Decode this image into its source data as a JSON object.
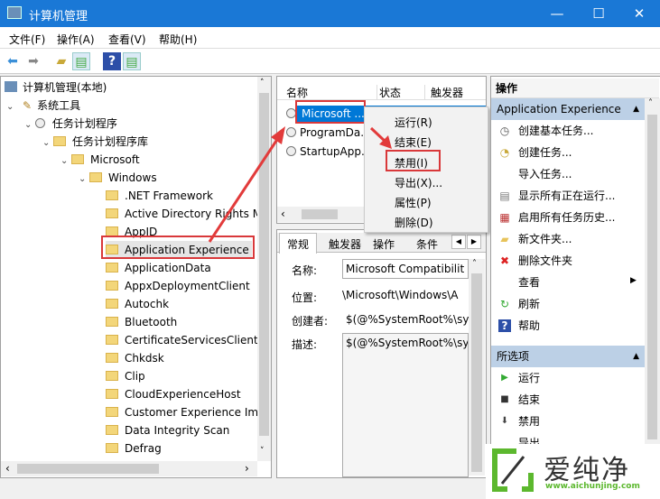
{
  "window": {
    "title": "计算机管理",
    "minimize": "—",
    "maximize": "☐",
    "close": "✕"
  },
  "menu": [
    "文件(F)",
    "操作(A)",
    "查看(V)",
    "帮助(H)"
  ],
  "toolbar": [
    "back-icon",
    "forward-icon",
    "up-folder-icon",
    "show-hide-tree-icon",
    "help-icon",
    "show-hide-action-pane-icon"
  ],
  "tree": {
    "root": "计算机管理(本地)",
    "system_tools": "系统工具",
    "task_scheduler": "任务计划程序",
    "library": "任务计划程序库",
    "microsoft": "Microsoft",
    "windows": "Windows",
    "folders": [
      ".NET Framework",
      "Active Directory Rights M",
      "AppID",
      "Application Experience",
      "ApplicationData",
      "AppxDeploymentClient",
      "Autochk",
      "Bluetooth",
      "CertificateServicesClient",
      "Chkdsk",
      "Clip",
      "CloudExperienceHost",
      "Customer Experience Im",
      "Data Integrity Scan",
      "Defrag"
    ],
    "selected": "Application Experience"
  },
  "tasks": {
    "columns": [
      "名称",
      "状态",
      "触发器"
    ],
    "rows": [
      "Microsoft ...",
      "ProgramDa...",
      "StartupApp..."
    ]
  },
  "context_menu": [
    "运行(R)",
    "结束(E)",
    "禁用(I)",
    "导出(X)...",
    "属性(P)",
    "删除(D)"
  ],
  "details": {
    "tabs": [
      "常规",
      "触发器",
      "操作",
      "条件"
    ],
    "name_label": "名称:",
    "name_value": "Microsoft Compatibilit",
    "location_label": "位置:",
    "location_value": "\\Microsoft\\Windows\\A",
    "author_label": "创建者:",
    "author_value": "$(@%SystemRoot%\\sy",
    "desc_label": "描述:",
    "desc_value": "$(@%SystemRoot%\\sy"
  },
  "actions": {
    "header": "操作",
    "section1": "Application Experience",
    "items1": [
      "创建基本任务...",
      "创建任务...",
      "导入任务...",
      "显示所有正在运行...",
      "启用所有任务历史...",
      "新文件夹...",
      "删除文件夹",
      "查看",
      "刷新",
      "帮助"
    ],
    "section2": "所选项",
    "items2": [
      "运行",
      "结束",
      "禁用",
      "导出"
    ]
  },
  "watermark": {
    "brand": "爱纯净",
    "url": "www.aichunjing.com"
  },
  "colors": {
    "titlebar": "#1a78d6",
    "selection": "#0078d7",
    "highlight_box": "#d9383a",
    "watermark_green": "#5cb82e"
  }
}
